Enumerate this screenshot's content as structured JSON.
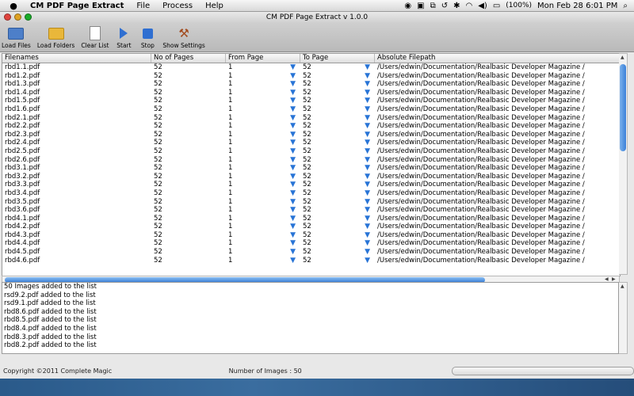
{
  "menubar": {
    "apple": "",
    "app_name": "CM PDF Page Extract",
    "menus": [
      "File",
      "Process",
      "Help"
    ],
    "battery": "(100%)",
    "clock": "Mon Feb 28  6:01 PM"
  },
  "window": {
    "title": "CM PDF Page Extract v 1.0.0"
  },
  "toolbar": {
    "load_files": "Load Files",
    "load_folders": "Load Folders",
    "clear_list": "Clear List",
    "start": "Start",
    "stop": "Stop",
    "show_settings": "Show Settings"
  },
  "table": {
    "headers": [
      "Filenames",
      "No of Pages",
      "From Page",
      "To Page",
      "Absolute Filepath"
    ],
    "rows": [
      [
        "rbd1.1.pdf",
        "52",
        "1",
        "52",
        "/Users/edwin/Documentation/Realbasic Developer Magazine /"
      ],
      [
        "rbd1.2.pdf",
        "52",
        "1",
        "52",
        "/Users/edwin/Documentation/Realbasic Developer Magazine /"
      ],
      [
        "rbd1.3.pdf",
        "52",
        "1",
        "52",
        "/Users/edwin/Documentation/Realbasic Developer Magazine /"
      ],
      [
        "rbd1.4.pdf",
        "52",
        "1",
        "52",
        "/Users/edwin/Documentation/Realbasic Developer Magazine /"
      ],
      [
        "rbd1.5.pdf",
        "52",
        "1",
        "52",
        "/Users/edwin/Documentation/Realbasic Developer Magazine /"
      ],
      [
        "rbd1.6.pdf",
        "52",
        "1",
        "52",
        "/Users/edwin/Documentation/Realbasic Developer Magazine /"
      ],
      [
        "rbd2.1.pdf",
        "52",
        "1",
        "52",
        "/Users/edwin/Documentation/Realbasic Developer Magazine /"
      ],
      [
        "rbd2.2.pdf",
        "52",
        "1",
        "52",
        "/Users/edwin/Documentation/Realbasic Developer Magazine /"
      ],
      [
        "rbd2.3.pdf",
        "52",
        "1",
        "52",
        "/Users/edwin/Documentation/Realbasic Developer Magazine /"
      ],
      [
        "rbd2.4.pdf",
        "52",
        "1",
        "52",
        "/Users/edwin/Documentation/Realbasic Developer Magazine /"
      ],
      [
        "rbd2.5.pdf",
        "52",
        "1",
        "52",
        "/Users/edwin/Documentation/Realbasic Developer Magazine /"
      ],
      [
        "rbd2.6.pdf",
        "52",
        "1",
        "52",
        "/Users/edwin/Documentation/Realbasic Developer Magazine /"
      ],
      [
        "rbd3.1.pdf",
        "52",
        "1",
        "52",
        "/Users/edwin/Documentation/Realbasic Developer Magazine /"
      ],
      [
        "rbd3.2.pdf",
        "52",
        "1",
        "52",
        "/Users/edwin/Documentation/Realbasic Developer Magazine /"
      ],
      [
        "rbd3.3.pdf",
        "52",
        "1",
        "52",
        "/Users/edwin/Documentation/Realbasic Developer Magazine /"
      ],
      [
        "rbd3.4.pdf",
        "52",
        "1",
        "52",
        "/Users/edwin/Documentation/Realbasic Developer Magazine /"
      ],
      [
        "rbd3.5.pdf",
        "52",
        "1",
        "52",
        "/Users/edwin/Documentation/Realbasic Developer Magazine /"
      ],
      [
        "rbd3.6.pdf",
        "52",
        "1",
        "52",
        "/Users/edwin/Documentation/Realbasic Developer Magazine /"
      ],
      [
        "rbd4.1.pdf",
        "52",
        "1",
        "52",
        "/Users/edwin/Documentation/Realbasic Developer Magazine /"
      ],
      [
        "rbd4.2.pdf",
        "52",
        "1",
        "52",
        "/Users/edwin/Documentation/Realbasic Developer Magazine /"
      ],
      [
        "rbd4.3.pdf",
        "52",
        "1",
        "52",
        "/Users/edwin/Documentation/Realbasic Developer Magazine /"
      ],
      [
        "rbd4.4.pdf",
        "52",
        "1",
        "52",
        "/Users/edwin/Documentation/Realbasic Developer Magazine /"
      ],
      [
        "rbd4.5.pdf",
        "52",
        "1",
        "52",
        "/Users/edwin/Documentation/Realbasic Developer Magazine /"
      ],
      [
        "rbd4.6.pdf",
        "52",
        "1",
        "52",
        "/Users/edwin/Documentation/Realbasic Developer Magazine /"
      ]
    ]
  },
  "log": {
    "lines": [
      "50 Images added to the list",
      "rsd9.2.pdf added to the list",
      "rsd9.1.pdf added to the list",
      "rbd8.6.pdf added to the list",
      "rbd8.5.pdf added to the list",
      "rbd8.4.pdf added to the list",
      "rbd8.3.pdf added to the list",
      "rbd8.2.pdf added to the list"
    ]
  },
  "status": {
    "copyright": "Copyright ©2011 Complete Magic",
    "image_count": "Number of Images : 50"
  },
  "colors": {
    "accent": "#2f77d4",
    "arrow": "#2874d6"
  }
}
